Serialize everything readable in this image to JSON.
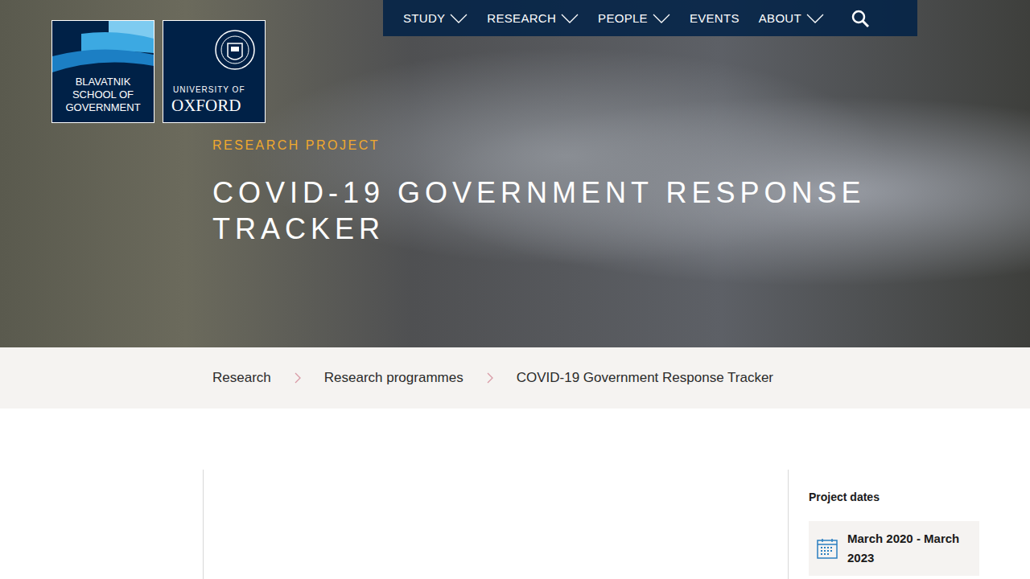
{
  "logos": {
    "school": [
      "BLAVATNIK",
      "SCHOOL OF",
      "GOVERNMENT"
    ],
    "university": {
      "small": "UNIVERSITY OF",
      "large": "OXFORD"
    }
  },
  "nav": [
    {
      "label": "STUDY",
      "dropdown": true
    },
    {
      "label": "RESEARCH",
      "dropdown": true
    },
    {
      "label": "PEOPLE",
      "dropdown": true
    },
    {
      "label": "EVENTS",
      "dropdown": false
    },
    {
      "label": "ABOUT",
      "dropdown": true
    }
  ],
  "hero": {
    "kicker": "RESEARCH PROJECT",
    "title": "COVID-19 GOVERNMENT RESPONSE TRACKER"
  },
  "breadcrumbs": [
    "Research",
    "Research programmes",
    "COVID-19 Government Response Tracker"
  ],
  "sidebar": {
    "heading": "Project dates",
    "dates": "March 2020 - March 2023"
  }
}
